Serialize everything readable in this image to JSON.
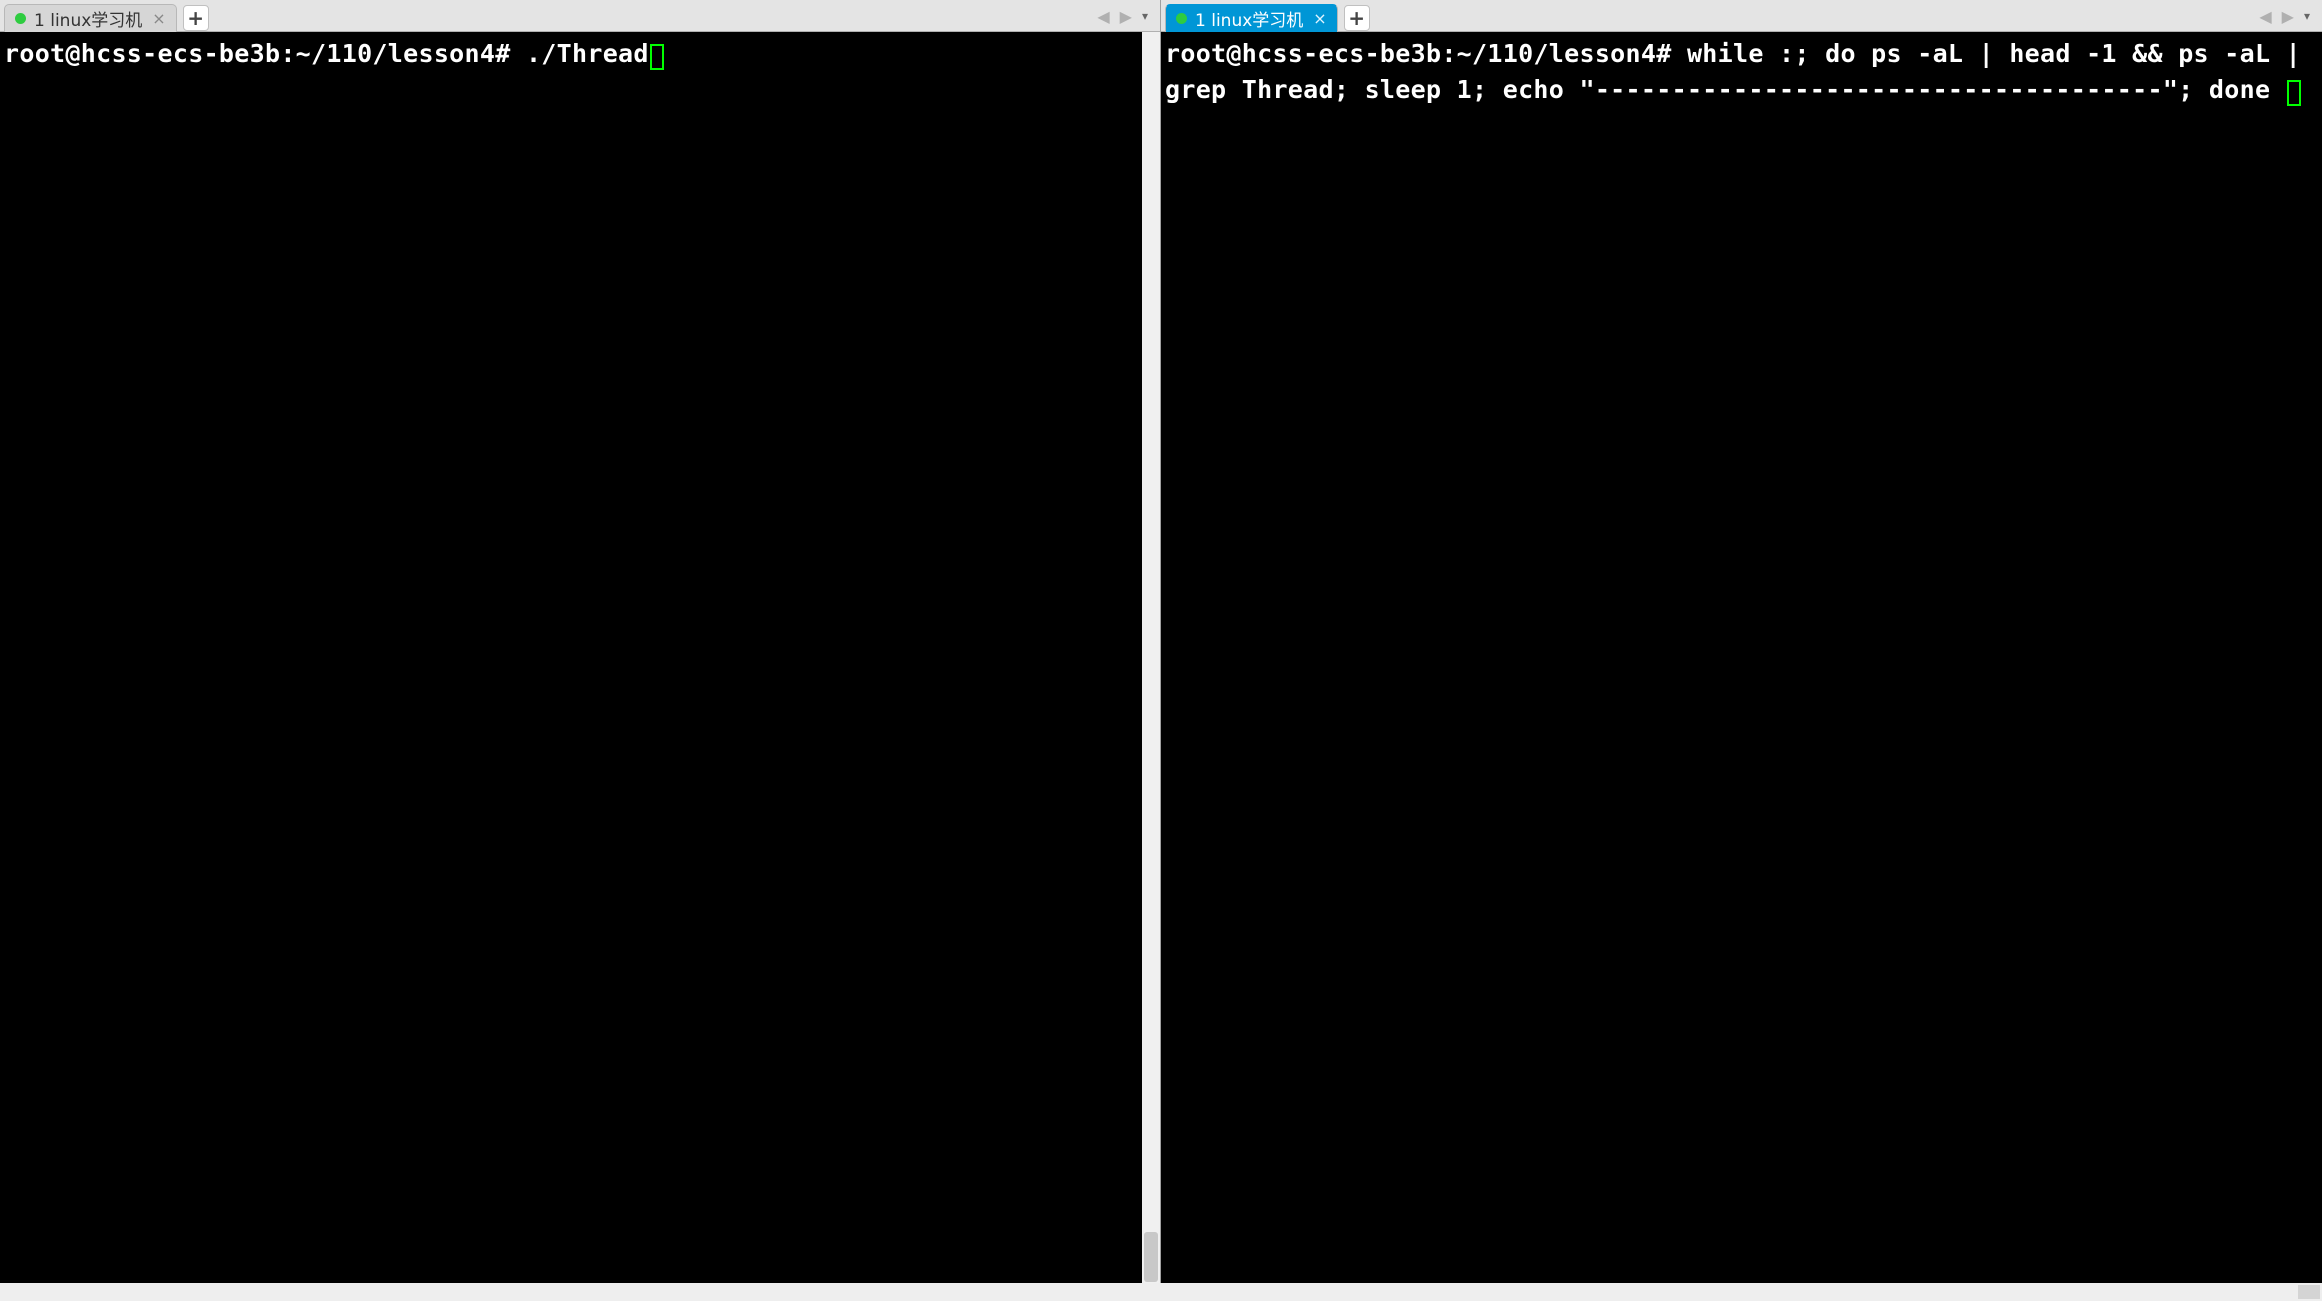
{
  "left_pane": {
    "tab": {
      "status": "connected",
      "label": "1 linux学习机",
      "close_label": "×"
    },
    "new_tab_label": "+",
    "nav": {
      "prev": "◀",
      "next": "▶",
      "dropdown": "▾"
    },
    "terminal": {
      "prompt": "root@hcss-ecs-be3b:~/110/lesson4# ",
      "command": "./Thread"
    }
  },
  "right_pane": {
    "tab": {
      "status": "connected",
      "label": "1 linux学习机",
      "close_label": "×"
    },
    "new_tab_label": "+",
    "nav": {
      "prev": "◀",
      "next": "▶",
      "dropdown": "▾"
    },
    "terminal": {
      "prompt": "root@hcss-ecs-be3b:~/110/lesson4# ",
      "command": "while :; do ps -aL | head -1 && ps -aL | grep Thread; sleep 1; echo \"-------------------------------------\"; done "
    }
  }
}
